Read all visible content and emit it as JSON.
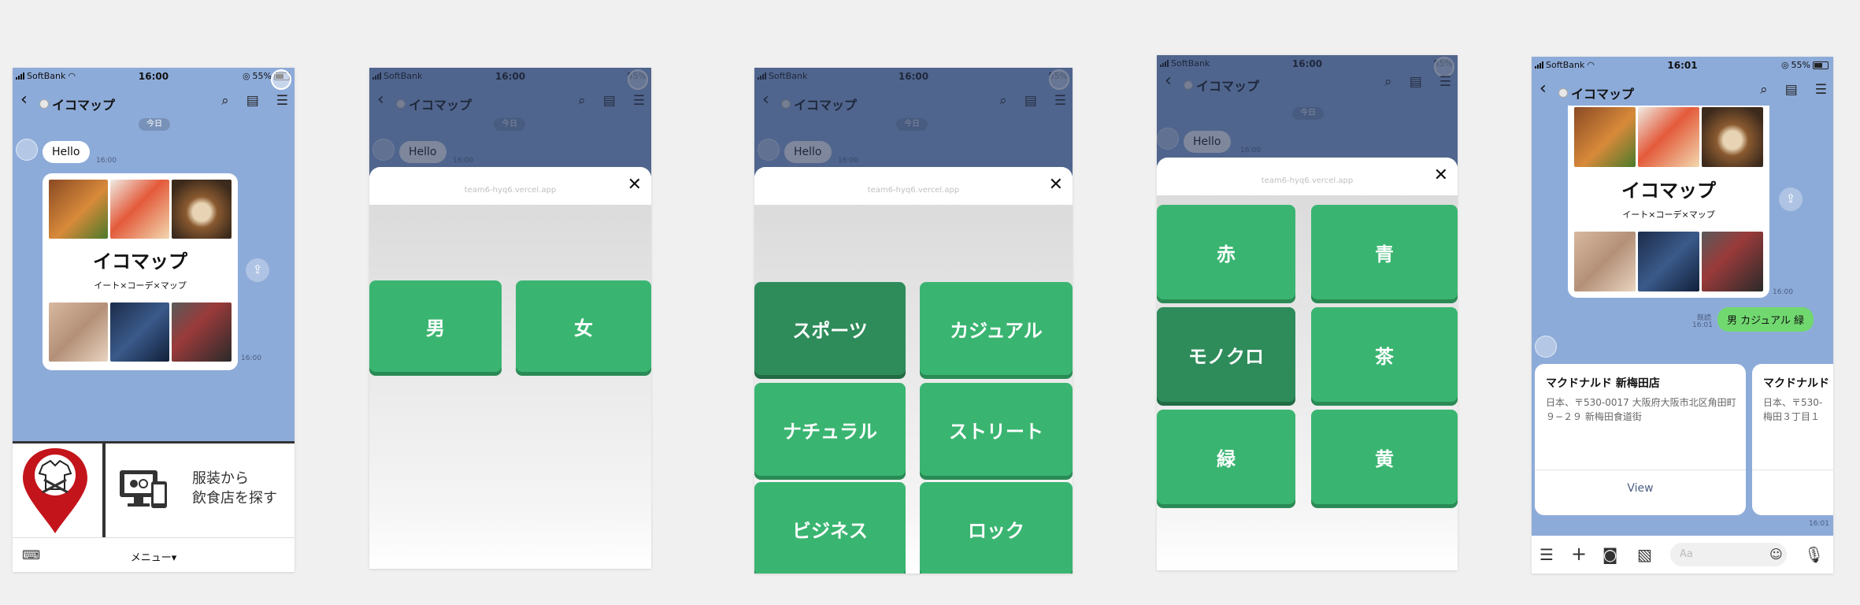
{
  "status": {
    "carrier": "SoftBank",
    "battery": "55%",
    "time_a": "16:00",
    "time_b": "16:01"
  },
  "header": {
    "title": "イコマップ",
    "back_icon": "chevron-left-icon",
    "search_icon": "search-clock-icon",
    "notes_icon": "notes-icon",
    "menu_icon": "hamburger-icon"
  },
  "chat": {
    "date": "今日",
    "greeting": "Hello",
    "greeting_time": "16:00",
    "card_title": "イコマップ",
    "card_subtitle": "イート×コーデ×マップ",
    "card_time": "16:00",
    "card_time_b": "16:00",
    "read_label": "既読",
    "sent_time": "16:01",
    "sent_message": "男 カジュアル 緑",
    "carousel_time": "16:01"
  },
  "richmenu": {
    "label": "服装から\n飲食店を探す",
    "menu_label": "メニュー▾"
  },
  "webview": {
    "url": "team6-hyq6.vercel.app"
  },
  "gender_options": [
    "男",
    "女"
  ],
  "style_options": [
    "スポーツ",
    "カジュアル",
    "ナチュラル",
    "ストリート",
    "ビジネス",
    "ロック"
  ],
  "color_options": [
    "赤",
    "青",
    "モノクロ",
    "茶",
    "緑",
    "黄"
  ],
  "places": [
    {
      "name": "マクドナルド 新梅田店",
      "address": "日本、〒530-0017 大阪府大阪市北区角田町９−２９ 新梅田食道街",
      "action": "View"
    },
    {
      "name": "マクドナルド",
      "address": "日本、〒530-\n梅田３丁目１",
      "action": ""
    }
  ],
  "input": {
    "placeholder": "Aa"
  },
  "colors": {
    "chat_bg": "#8dabd9",
    "button_green": "#3ab571",
    "button_selected": "#2e8c5a",
    "sent_bubble": "#70d86f"
  }
}
